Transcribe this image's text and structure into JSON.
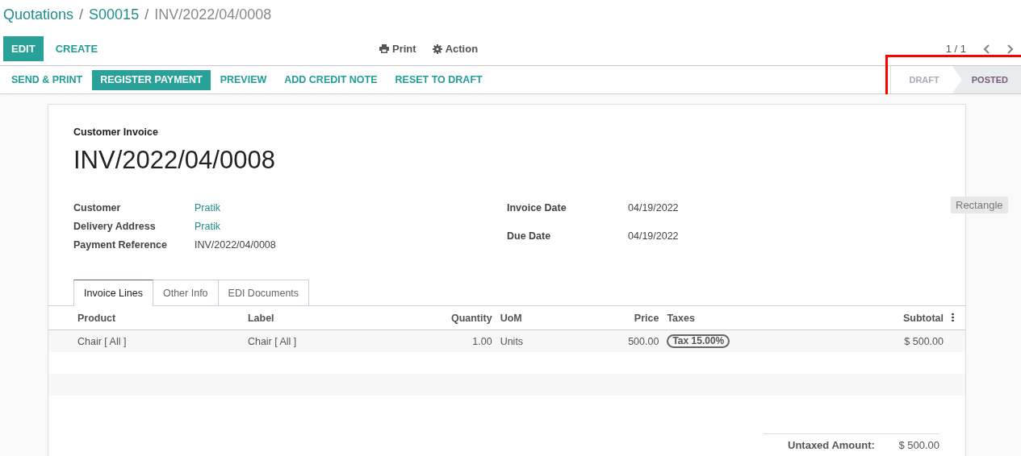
{
  "breadcrumb": [
    {
      "label": "Quotations",
      "link": true
    },
    {
      "separator": "/",
      "label": "S00015",
      "link": true
    },
    {
      "separator": "/",
      "label": "INV/2022/04/0008",
      "link": false
    }
  ],
  "control_buttons": [
    {
      "label": "EDIT",
      "primary": true
    },
    {
      "label": "CREATE",
      "primary": false
    }
  ],
  "menus": [
    {
      "kind": "print",
      "label": "Print"
    },
    {
      "kind": "gear",
      "label": "Action"
    }
  ],
  "pager": {
    "text": "1 / 1"
  },
  "header_buttons": [
    {
      "label": "SEND & PRINT",
      "primary": false
    },
    {
      "label": "REGISTER PAYMENT",
      "primary": true
    },
    {
      "label": "PREVIEW",
      "primary": false
    },
    {
      "label": "ADD CREDIT NOTE",
      "primary": false
    },
    {
      "label": "RESET TO DRAFT",
      "primary": false
    }
  ],
  "status_bar": [
    {
      "label": "DRAFT",
      "selected": false
    },
    {
      "label": "POSTED",
      "selected": true
    }
  ],
  "annotation": {
    "highlight": true,
    "label": "Rectangle"
  },
  "sheet": {
    "document_type": "Customer Invoice",
    "number": "INV/2022/04/0008",
    "left_fields": [
      {
        "label": "Customer",
        "value": "Pratik",
        "link": true
      },
      {
        "label": "Delivery Address",
        "value": "Pratik",
        "link": true
      },
      {
        "label": "Payment Reference",
        "value": "INV/2022/04/0008",
        "link": false
      }
    ],
    "right_fields": [
      {
        "label": "Invoice Date",
        "value": "04/19/2022",
        "link": false
      },
      {
        "label": "Due Date",
        "value": "04/19/2022",
        "link": false
      }
    ],
    "tabs": [
      {
        "label": "Invoice Lines",
        "selected": true
      },
      {
        "label": "Other Info",
        "selected": false
      },
      {
        "label": "EDI Documents",
        "selected": false
      }
    ],
    "table": {
      "columns": [
        "Product",
        "Label",
        "Quantity",
        "UoM",
        "Price",
        "Taxes",
        "Subtotal"
      ],
      "rows": [
        {
          "cells": [
            "Chair [ All ]",
            "Chair [ All ]",
            "1.00",
            "Units",
            "500.00",
            {
              "tag": "Tax 15.00%"
            },
            "$ 500.00"
          ]
        }
      ]
    },
    "totals": [
      {
        "label": "Untaxed Amount:",
        "value": "$ 500.00"
      }
    ]
  }
}
